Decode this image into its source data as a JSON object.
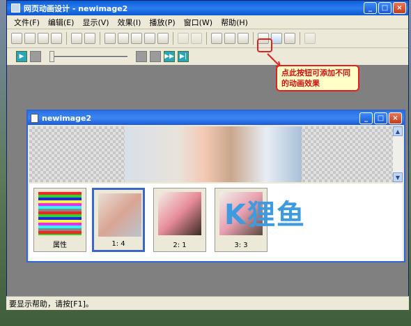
{
  "app": {
    "title": "网页动画设计 - newimage2",
    "window_buttons": [
      "_",
      "□",
      "×"
    ]
  },
  "menu": [
    "文件(F)",
    "编辑(E)",
    "显示(V)",
    "效果(I)",
    "播放(P)",
    "窗口(W)",
    "帮助(H)"
  ],
  "toolbar": {
    "buttons": [
      "new-icon",
      "open-icon",
      "save-icon",
      "save-as-icon",
      "import-icon",
      "export-icon",
      "cut-icon",
      "copy-icon",
      "paste-icon",
      "erase-icon",
      "duplicate-icon",
      "undo-icon",
      "redo-icon",
      "properties-icon",
      "list-icon",
      "frame-icon",
      "image-effect-icon",
      "animation-effect-icon",
      "text-effect-icon",
      "pen-icon"
    ]
  },
  "playbar": {
    "play_label": "▶",
    "slider_position": 0
  },
  "callout": {
    "text": "点此按钮可添加不同的动画效果"
  },
  "child": {
    "title": "newimage2"
  },
  "frames": [
    {
      "caption": "属性",
      "selected": false
    },
    {
      "caption": "1: 4",
      "selected": true
    },
    {
      "caption": "2: 1",
      "selected": false
    },
    {
      "caption": "3: 3",
      "selected": false
    }
  ],
  "watermark": "K狸鱼",
  "status": {
    "text": "要显示帮助，请按[F1]。"
  }
}
